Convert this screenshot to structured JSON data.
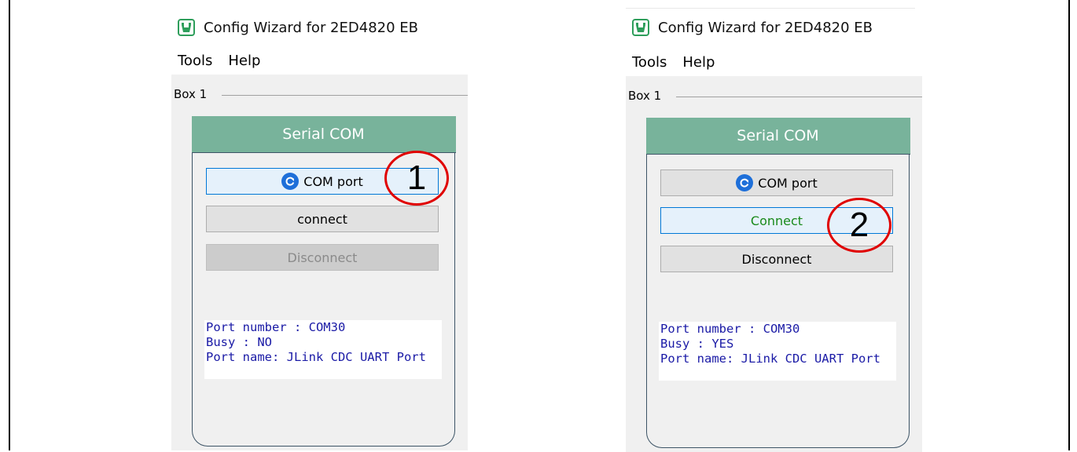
{
  "panels": [
    {
      "title": "Config Wizard for 2ED4820 EB",
      "menu": [
        "Tools",
        "Help"
      ],
      "groupbox": "Box 1",
      "card_header": "Serial COM",
      "buttons": {
        "com_port": "COM port",
        "connect": "connect",
        "disconnect": "Disconnect"
      },
      "info": {
        "port_number": "Port number : COM30",
        "busy": "Busy : NO",
        "port_name": "Port name: JLink CDC UART Port"
      },
      "annotation": "1"
    },
    {
      "title": "Config Wizard for 2ED4820 EB",
      "menu": [
        "Tools",
        "Help"
      ],
      "groupbox": "Box 1",
      "card_header": "Serial COM",
      "buttons": {
        "com_port": "COM port",
        "connect": "Connect",
        "disconnect": "Disconnect"
      },
      "info": {
        "port_number": "Port number : COM30",
        "busy": "Busy : YES",
        "port_name": "Port name: JLink CDC UART Port"
      },
      "annotation": "2"
    }
  ],
  "colors": {
    "card_header": "#78b39b",
    "annotation_ring": "#e00000",
    "info_text": "#1a1aa6",
    "connect_active_text": "#1a8a1a",
    "refresh_icon": "#1e6fd9"
  },
  "icons": [
    "app-logo-icon",
    "refresh-icon"
  ]
}
